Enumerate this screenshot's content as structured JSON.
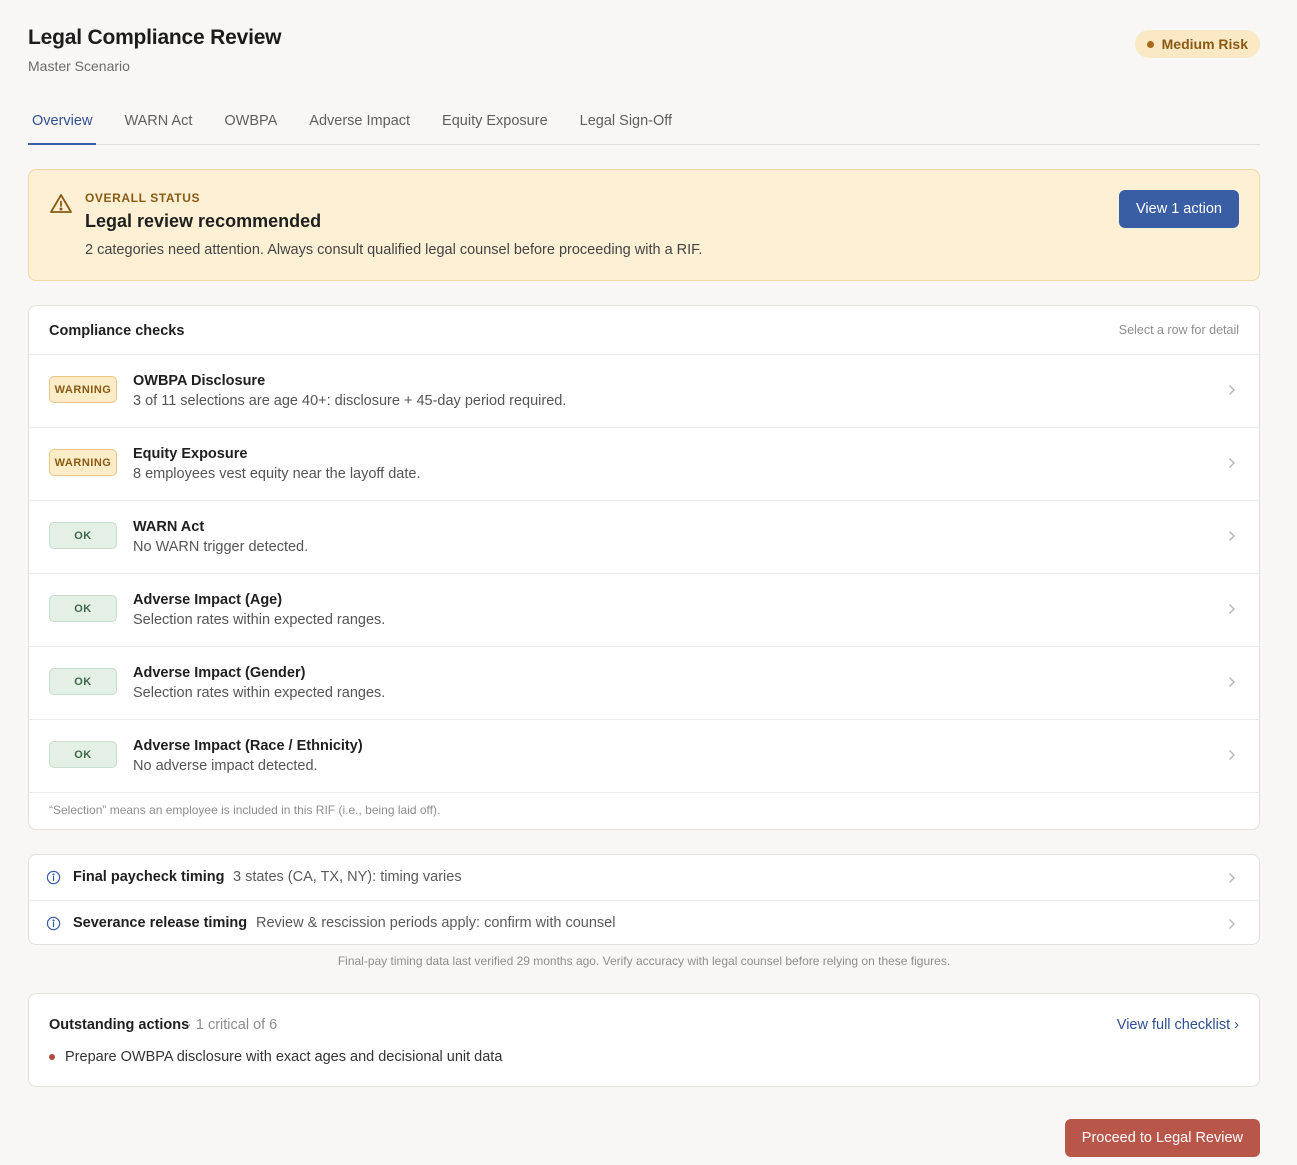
{
  "header": {
    "title": "Legal Compliance Review",
    "subtitle": "Master Scenario",
    "risk_badge": "Medium Risk"
  },
  "tabs": [
    {
      "label": "Overview",
      "active": true
    },
    {
      "label": "WARN Act",
      "active": false
    },
    {
      "label": "OWBPA",
      "active": false
    },
    {
      "label": "Adverse Impact",
      "active": false
    },
    {
      "label": "Equity Exposure",
      "active": false
    },
    {
      "label": "Legal Sign-Off",
      "active": false
    }
  ],
  "status": {
    "eyebrow": "OVERALL STATUS",
    "title": "Legal review recommended",
    "description": "2 categories need attention. Always consult qualified legal counsel before proceeding with a RIF.",
    "action_label": "View 1 action",
    "icon": "warning-triangle-icon"
  },
  "checks": {
    "title": "Compliance checks",
    "hint": "Select a row for detail",
    "rows": [
      {
        "status": "WARNING",
        "name": "OWBPA Disclosure",
        "description": "3 of 11 selections are age 40+: disclosure + 45-day period required."
      },
      {
        "status": "WARNING",
        "name": "Equity Exposure",
        "description": "8 employees vest equity near the layoff date."
      },
      {
        "status": "OK",
        "name": "WARN Act",
        "description": "No WARN trigger detected."
      },
      {
        "status": "OK",
        "name": "Adverse Impact (Age)",
        "description": "Selection rates within expected ranges."
      },
      {
        "status": "OK",
        "name": "Adverse Impact (Gender)",
        "description": "Selection rates within expected ranges."
      },
      {
        "status": "OK",
        "name": "Adverse Impact (Race / Ethnicity)",
        "description": "No adverse impact detected."
      }
    ],
    "footnote": "“Selection” means an employee is included in this RIF (i.e., being laid off)."
  },
  "timing": {
    "rows": [
      {
        "label": "Final paycheck timing",
        "value": "3 states (CA, TX, NY): timing varies"
      },
      {
        "label": "Severance release timing",
        "value": "Review & rescission periods apply: confirm with counsel"
      }
    ],
    "note": "Final-pay timing data last verified 29 months ago. Verify accuracy with legal counsel before relying on these figures."
  },
  "actions": {
    "title": "Outstanding actions",
    "count": "· 1 critical of 6",
    "link": "View full checklist ›",
    "items": [
      "Prepare OWBPA disclosure with exact ages and decisional unit data"
    ]
  },
  "footer": {
    "proceed_label": "Proceed to Legal Review"
  },
  "colors": {
    "accent": "#3a5ea4",
    "warning_bg": "#fdf0d5",
    "danger_button": "#b8564a"
  }
}
